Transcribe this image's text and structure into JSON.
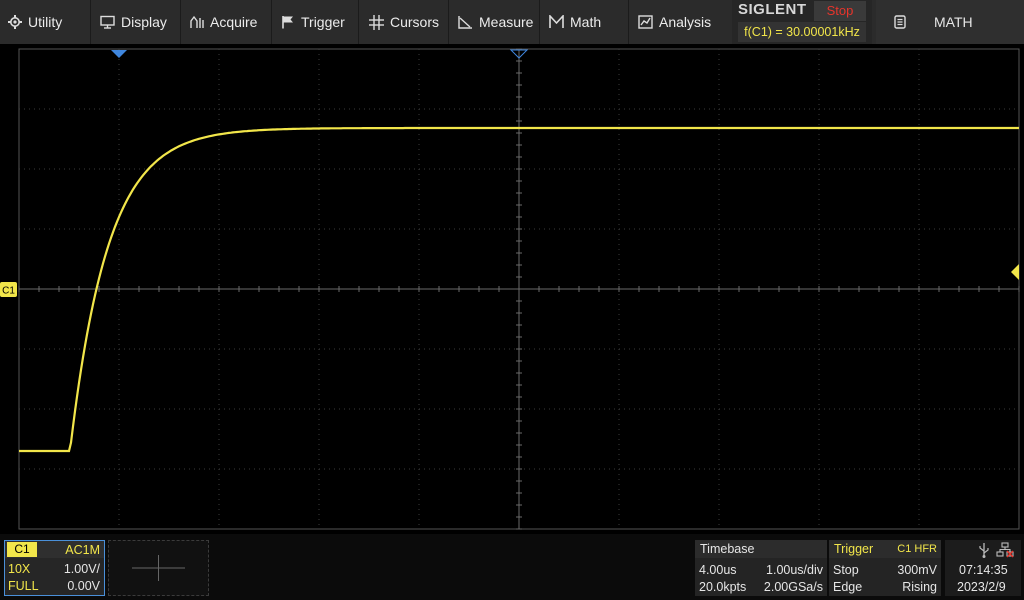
{
  "menu": {
    "utility": "Utility",
    "display": "Display",
    "acquire": "Acquire",
    "trigger": "Trigger",
    "cursors": "Cursors",
    "measure": "Measure",
    "math": "Math",
    "analysis": "Analysis"
  },
  "brand": {
    "logo": "SIGLENT",
    "run_state": "Stop",
    "frequency": "f(C1) = 30.00001kHz"
  },
  "math_button": "MATH",
  "channel_marker": "C1",
  "channel1": {
    "name": "C1",
    "coupling": "AC1M",
    "probe": "10X",
    "scale": "1.00V/",
    "bandwidth": "FULL",
    "offset": "0.00V",
    "color": "#f2e64a"
  },
  "timebase": {
    "title": "Timebase",
    "delay": "4.00us",
    "scale": "1.00us/div",
    "points": "20.0kpts",
    "sample_rate": "2.00GSa/s"
  },
  "trigger": {
    "title": "Trigger",
    "source": "C1 HFR",
    "mode": "Stop",
    "level": "300mV",
    "type": "Edge",
    "slope": "Rising"
  },
  "clock": {
    "time": "07:14:35",
    "date": "2023/2/9"
  },
  "colors": {
    "trace": "#f2e64a",
    "marker_blue": "#3f86de",
    "stop_red": "#e8342b"
  }
}
